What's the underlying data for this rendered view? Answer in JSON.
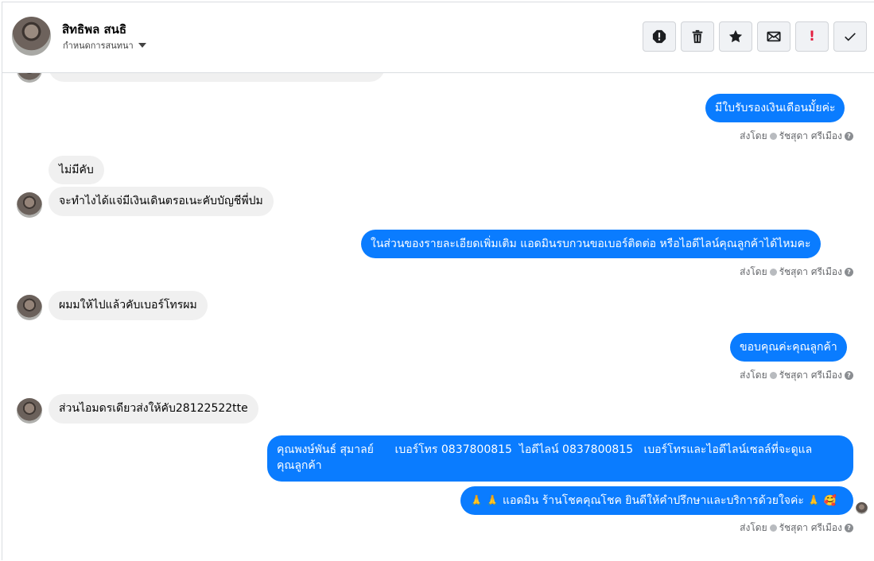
{
  "header": {
    "contact_name": "สิทธิพล สนธิ",
    "subtitle": "กำหนดการสนทนา",
    "actions": [
      {
        "name": "spam-icon"
      },
      {
        "name": "trash-icon"
      },
      {
        "name": "star-icon"
      },
      {
        "name": "mail-icon"
      },
      {
        "name": "important-icon",
        "label": "!"
      },
      {
        "name": "check-icon"
      }
    ]
  },
  "messages": {
    "out1": "มีใบรับรองเงินเดือนมั้ยค่ะ",
    "in1": "ไม่มีคับ",
    "in2": "จะทำไงได้แจ่มีเงินเดินตรอเนะคับบัญชีพี่ปม",
    "out2": "ในส่วนของรายละเอียดเพิ่มเติม แอดมินรบกวนขอเบอร์ติดต่อ หรือไอดีไลน์คุณลูกค้าได้ไหมคะ",
    "in3": "ผมมให้ไปแล้วคับเบอร์โทรผม",
    "out3": "ขอบคุณค่ะคุณลูกค้า",
    "in4": "ส่วนไอมดรเดียวส่งให้คับ28122522tte",
    "out4_line1": "คุณพงษ์พันธ์ สุมาลย์      เบอร์โทร 0837800815  ไอดีไลน์ 0837800815   เบอร์โทรและไอดีไลน์เซลล์ที่จะดูแล",
    "out4_line2": "คุณลูกค้า",
    "out5_prefix": "🙏 🙏",
    "out5_text": "แอดมิน ร้านโชคคุณโชค ยินดีให้คำปรึกษาและบริการด้วยใจค่ะ",
    "out5_suffix": "🙏 🥰"
  },
  "sent_by": {
    "prefix": "ส่งโดย",
    "name": "รัชสุดา ศรีเมือง",
    "help": "?"
  },
  "colors": {
    "outgoing_bubble": "#0a7cff",
    "incoming_bubble": "#f0f0f0",
    "important": "#e41e3f"
  }
}
